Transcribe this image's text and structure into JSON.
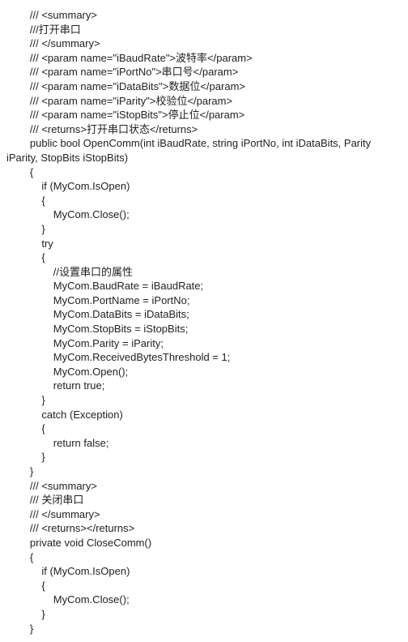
{
  "lines": [
    {
      "pad": "        ",
      "text": "/// <summary>"
    },
    {
      "pad": "        ",
      "text": "///打开串口"
    },
    {
      "pad": "        ",
      "text": "/// </summary>"
    },
    {
      "pad": "        ",
      "text": "/// <param name=\"iBaudRate\">波特率</param>"
    },
    {
      "pad": "        ",
      "text": "/// <param name=\"iPortNo\">串口号</param>"
    },
    {
      "pad": "        ",
      "text": "/// <param name=\"iDataBits\">数据位</param>"
    },
    {
      "pad": "        ",
      "text": "/// <param name=\"iParity\">校验位</param>"
    },
    {
      "pad": "        ",
      "text": "/// <param name=\"iStopBits\">停止位</param>"
    },
    {
      "pad": "        ",
      "text": "/// <returns>打开串口状态</returns>"
    },
    {
      "pad": "        ",
      "text": "public bool OpenComm(int iBaudRate, string iPortNo, int iDataBits, Parity"
    },
    {
      "pad": "",
      "text": "iParity, StopBits iStopBits)"
    },
    {
      "pad": "        ",
      "text": "{"
    },
    {
      "pad": "            ",
      "text": "if (MyCom.IsOpen)"
    },
    {
      "pad": "            ",
      "text": "{"
    },
    {
      "pad": "                ",
      "text": "MyCom.Close();"
    },
    {
      "pad": "            ",
      "text": "}"
    },
    {
      "pad": "            ",
      "text": "try"
    },
    {
      "pad": "            ",
      "text": "{"
    },
    {
      "pad": "                ",
      "text": "//设置串口的属性"
    },
    {
      "pad": "                ",
      "text": "MyCom.BaudRate = iBaudRate;"
    },
    {
      "pad": "                ",
      "text": "MyCom.PortName = iPortNo;"
    },
    {
      "pad": "                ",
      "text": "MyCom.DataBits = iDataBits;"
    },
    {
      "pad": "                ",
      "text": "MyCom.StopBits = iStopBits;"
    },
    {
      "pad": "                ",
      "text": "MyCom.Parity = iParity;"
    },
    {
      "pad": "                ",
      "text": "MyCom.ReceivedBytesThreshold = 1;"
    },
    {
      "pad": "",
      "text": ""
    },
    {
      "pad": "                ",
      "text": "MyCom.Open();"
    },
    {
      "pad": "                ",
      "text": "return true;"
    },
    {
      "pad": "            ",
      "text": "}"
    },
    {
      "pad": "            ",
      "text": "catch (Exception)"
    },
    {
      "pad": "            ",
      "text": "{"
    },
    {
      "pad": "                ",
      "text": "return false;"
    },
    {
      "pad": "            ",
      "text": "}"
    },
    {
      "pad": "        ",
      "text": "}"
    },
    {
      "pad": "",
      "text": ""
    },
    {
      "pad": "        ",
      "text": "/// <summary>"
    },
    {
      "pad": "        ",
      "text": "/// 关闭串口"
    },
    {
      "pad": "        ",
      "text": "/// </summary>"
    },
    {
      "pad": "        ",
      "text": "/// <returns></returns>"
    },
    {
      "pad": "        ",
      "text": "private void CloseComm()"
    },
    {
      "pad": "        ",
      "text": "{"
    },
    {
      "pad": "            ",
      "text": "if (MyCom.IsOpen)"
    },
    {
      "pad": "            ",
      "text": "{"
    },
    {
      "pad": "                ",
      "text": "MyCom.Close();"
    },
    {
      "pad": "            ",
      "text": "}"
    },
    {
      "pad": "        ",
      "text": "}"
    }
  ]
}
